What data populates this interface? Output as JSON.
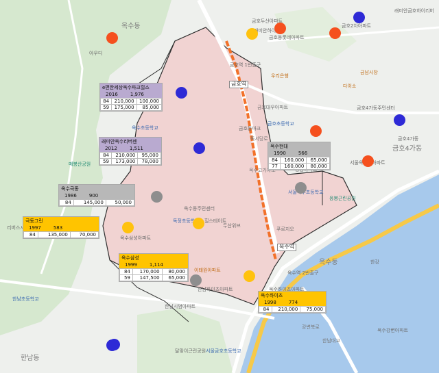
{
  "map": {
    "district_labels": {
      "oksu_top": "옥수동",
      "oksu_bottom": "옥수동",
      "hannam": "한남동",
      "geumho4": "금호4가동"
    },
    "station_labels": {
      "geumho": "금호역",
      "oksu": "옥수역"
    },
    "place_labels": [
      "금호두산아파트",
      "금호동롯데아파트",
      "금호2차아파트",
      "래미안금호하이리버",
      "래미안하이리버",
      "다이소",
      "금남시장",
      "금호4가동주민센터",
      "금호대우아파트",
      "금호초등학교",
      "옥수초등학교",
      "서울금호초등학교",
      "서울옥수초등학교",
      "서울옥수초아파트",
      "옥수동주민센터",
      "매봉산공원",
      "응봉근린공원",
      "한남초등학교",
      "리버스시티아파트",
      "극동아파트",
      "옥수삼성아파트",
      "옥수하이츠아파트",
      "독정초등학교",
      "한남하이츠아파트",
      "한남시범아파트",
      "달맞이근린공원",
      "이태원아파트",
      "힐스테이트",
      "푸르지오",
      "두산위브",
      "쌍용아파트",
      "금호동파크",
      "옥수강변아파트",
      "금호4가동",
      "한강",
      "금호역 1번출구",
      "아우디",
      "우리은행",
      "옥수역 2번출구",
      "독서당로",
      "옥수고가차도",
      "한남대교",
      "강변북로"
    ],
    "markers": [
      {
        "color": "#2e2ad6"
      },
      {
        "color": "#ffc20e"
      },
      {
        "color": "#f5501e"
      },
      {
        "color": "#f5501e"
      },
      {
        "color": "#f5501e"
      },
      {
        "color": "#2e2ad6"
      },
      {
        "color": "#f5501e"
      },
      {
        "color": "#2e2ad6"
      },
      {
        "color": "#2e2ad6"
      },
      {
        "color": "#f5501e"
      },
      {
        "color": "#2e2ad6"
      },
      {
        "color": "#8e8e8e"
      },
      {
        "color": "#8e8e8e"
      },
      {
        "color": "#ffc20e"
      },
      {
        "color": "#ffc20e"
      },
      {
        "color": "#8e8e8e"
      },
      {
        "color": "#ffc20e"
      },
      {
        "color": "#2e2ad6"
      }
    ],
    "apartments": [
      {
        "theme": "purple",
        "name": "e편한세상옥수파크힐스",
        "year": "2016",
        "units": "1,976",
        "rows": [
          [
            "84",
            "210,000",
            "100,000"
          ],
          [
            "59",
            "175,000",
            "85,000"
          ]
        ]
      },
      {
        "theme": "purple",
        "name": "래미안옥수리버젠",
        "year": "2012",
        "units": "1,511",
        "rows": [
          [
            "84",
            "210,000",
            "95,000"
          ],
          [
            "59",
            "173,000",
            "78,000"
          ]
        ]
      },
      {
        "theme": "gray",
        "name": "옥수현대",
        "year": "1990",
        "units": "566",
        "rows": [
          [
            "84",
            "160,000",
            "65,000"
          ],
          [
            "77",
            "160,000",
            "80,000"
          ]
        ]
      },
      {
        "theme": "gray",
        "name": "옥수극동",
        "year": "1986",
        "units": "900",
        "rows": [
          [
            "84",
            "145,000",
            "50,000"
          ]
        ]
      },
      {
        "theme": "gold",
        "name": "극동그린",
        "year": "1997",
        "units": "583",
        "rows": [
          [
            "84",
            "135,000",
            "70,000"
          ]
        ]
      },
      {
        "theme": "gold",
        "name": "옥수삼성",
        "year": "1999",
        "units": "1,114",
        "rows": [
          [
            "84",
            "170,000",
            "80,000"
          ],
          [
            "59",
            "147,500",
            "65,000"
          ]
        ]
      },
      {
        "theme": "gold",
        "name": "옥수하이츠",
        "year": "1998",
        "units": "774",
        "rows": [
          [
            "84",
            "210,000",
            "75,000"
          ]
        ]
      }
    ]
  }
}
